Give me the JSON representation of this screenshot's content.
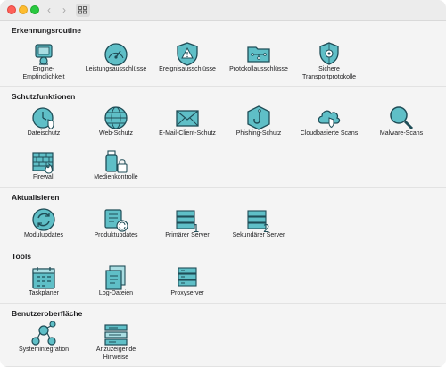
{
  "window": {
    "nav": {
      "back_icon": "‹",
      "forward_icon": "›"
    }
  },
  "colors": {
    "icon_fill": "#5fbfc7",
    "icon_stroke": "#1f4d57",
    "background": "#f4f4f4"
  },
  "sections": [
    {
      "title": "Erkennungsroutine",
      "items": [
        {
          "label": "Engine-\nEmpfindlichkeit",
          "icon": "engine-sensitivity-icon"
        },
        {
          "label": "Leistungsausschlüsse",
          "icon": "performance-gauge-icon"
        },
        {
          "label": "Ereignisausschlüsse",
          "icon": "warning-shield-icon"
        },
        {
          "label": "Protokollausschlüsse",
          "icon": "folder-network-icon"
        },
        {
          "label": "Sichere\nTransportprotokolle",
          "icon": "secure-transport-icon"
        }
      ]
    },
    {
      "title": "Schutzfunktionen",
      "items": [
        {
          "label": "Dateischutz",
          "icon": "file-protection-icon"
        },
        {
          "label": "Web-Schutz",
          "icon": "globe-icon"
        },
        {
          "label": "E-Mail-Client-Schutz",
          "icon": "envelope-icon"
        },
        {
          "label": "Phishing-Schutz",
          "icon": "fishhook-icon"
        },
        {
          "label": "Cloudbasierte Scans",
          "icon": "cloud-shield-icon"
        },
        {
          "label": "Malware-Scans",
          "icon": "magnifier-icon"
        },
        {
          "label": "Firewall",
          "icon": "firewall-icon"
        },
        {
          "label": "Medienkontrolle",
          "icon": "usb-lock-icon"
        }
      ]
    },
    {
      "title": "Aktualisieren",
      "items": [
        {
          "label": "Modulupdates",
          "icon": "refresh-icon"
        },
        {
          "label": "Produktupdates",
          "icon": "product-update-icon"
        },
        {
          "label": "Primärer Server",
          "icon": "server-primary-icon"
        },
        {
          "label": "Sekundärer Server",
          "icon": "server-secondary-icon"
        }
      ]
    },
    {
      "title": "Tools",
      "items": [
        {
          "label": "Taskplaner",
          "icon": "calendar-icon"
        },
        {
          "label": "Log-Dateien",
          "icon": "log-files-icon"
        },
        {
          "label": "Proxyserver",
          "icon": "proxy-server-icon"
        }
      ]
    },
    {
      "title": "Benutzeroberfläche",
      "items": [
        {
          "label": "Systemintegration",
          "icon": "system-integration-icon"
        },
        {
          "label": "Anzuzeigende\nHinweise",
          "icon": "notifications-icon"
        }
      ]
    }
  ]
}
